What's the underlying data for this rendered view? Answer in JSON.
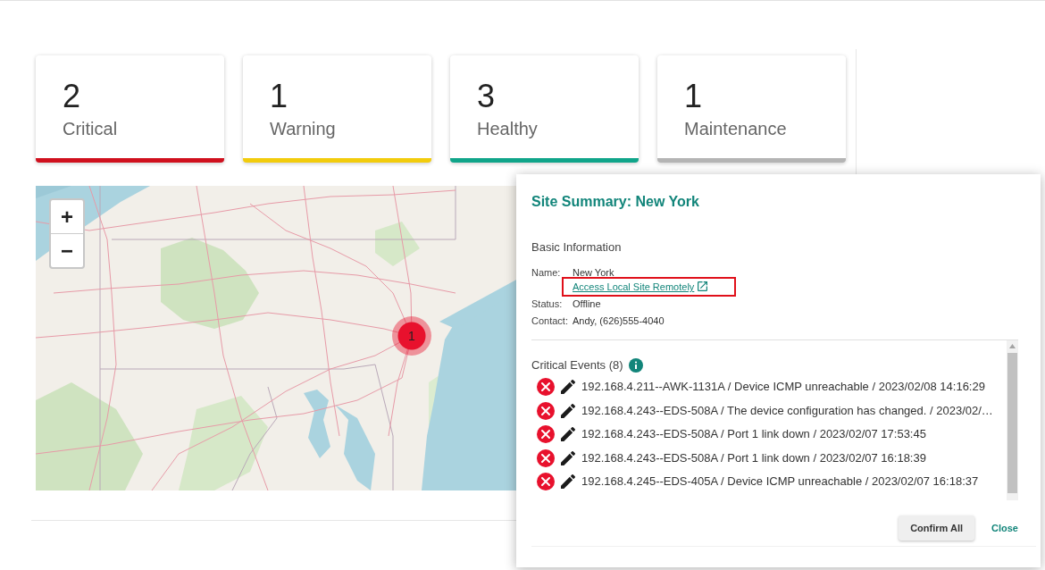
{
  "summary_cards": [
    {
      "count": "2",
      "label": "Critical",
      "color": "#d0101e"
    },
    {
      "count": "1",
      "label": "Warning",
      "color": "#f2cc0c"
    },
    {
      "count": "3",
      "label": "Healthy",
      "color": "#10a58a"
    },
    {
      "count": "1",
      "label": "Maintenance",
      "color": "#b4b4b4"
    }
  ],
  "map": {
    "zoom_in": "+",
    "zoom_out": "−",
    "cluster": {
      "count": "1"
    }
  },
  "site_summary": {
    "title": "Site Summary: New York",
    "section": "Basic Information",
    "fields": [
      {
        "label": "Name:",
        "value": "New York",
        "link": {
          "text": "Access Local Site Remotely",
          "highlighted": true
        }
      },
      {
        "label": "Status:",
        "value": "Offline"
      },
      {
        "label": "Contact:",
        "value": "Andy, (626)555-4040"
      }
    ],
    "events_title": "Critical Events (8)",
    "events": [
      {
        "text": "192.168.4.211--AWK-1131A / Device ICMP unreachable / 2023/02/08 14:16:29"
      },
      {
        "text": "192.168.4.243--EDS-508A / The device configuration has changed. / 2023/02/…"
      },
      {
        "text": "192.168.4.243--EDS-508A / Port 1 link down / 2023/02/07 17:53:45"
      },
      {
        "text": "192.168.4.243--EDS-508A / Port 1 link down / 2023/02/07 16:18:39"
      },
      {
        "text": "192.168.4.245--EDS-405A / Device ICMP unreachable / 2023/02/07 16:18:37"
      }
    ],
    "buttons": [
      {
        "label": "Confirm All",
        "kind": "raised"
      },
      {
        "label": "Close",
        "kind": "text"
      }
    ]
  }
}
